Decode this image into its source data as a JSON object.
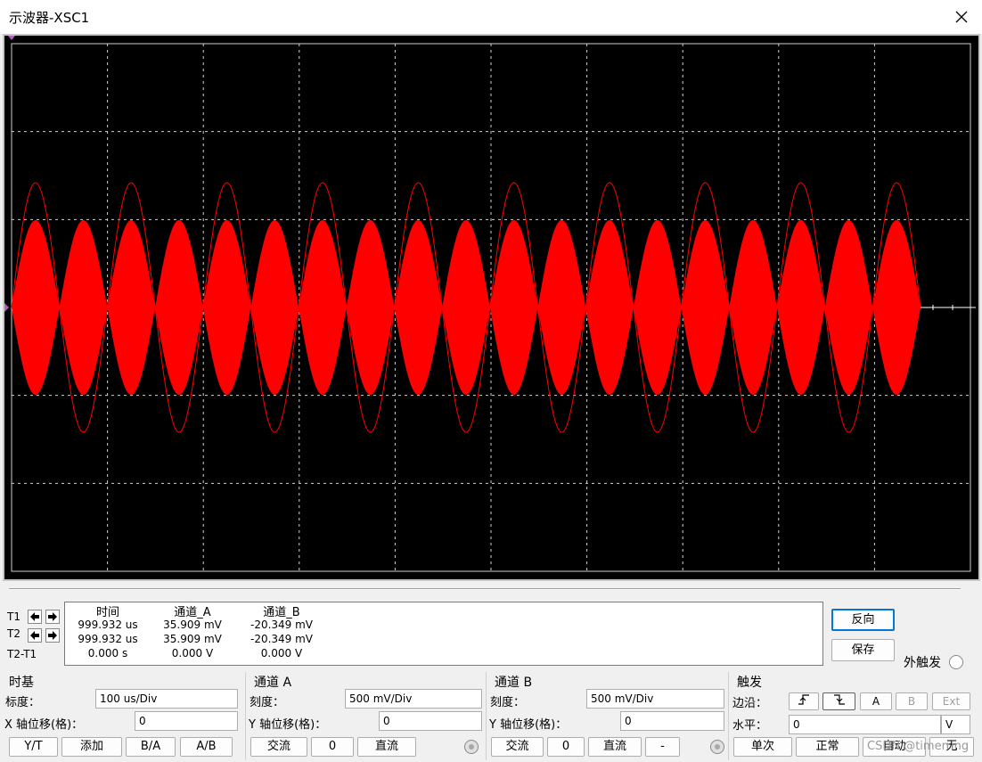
{
  "window": {
    "title": "示波器-XSC1"
  },
  "cursors": {
    "t1": "T1",
    "t2": "T2",
    "t2t1": "T2-T1"
  },
  "readout": {
    "headers": {
      "time": "时间",
      "channel_a": "通道_A",
      "channel_b": "通道_B"
    },
    "rows": [
      {
        "time": "999.932 us",
        "a": "35.909 mV",
        "b": "-20.349 mV"
      },
      {
        "time": "999.932 us",
        "a": "35.909 mV",
        "b": "-20.349 mV"
      },
      {
        "time": "0.000 s",
        "a": "0.000 V",
        "b": "0.000 V"
      }
    ]
  },
  "side": {
    "reverse": "反向",
    "save": "保存",
    "ext_trigger": "外触发"
  },
  "timebase": {
    "title": "时基",
    "scale_label": "标度：",
    "scale_value": "100 us/Div",
    "xpos_label": "X 轴位移(格)：",
    "xpos_value": "0",
    "buttons": [
      "Y/T",
      "添加",
      "B/A",
      "A/B"
    ]
  },
  "channel_a": {
    "title": "通道 A",
    "scale_label": "刻度：",
    "scale_value": "500 mV/Div",
    "ypos_label": "Y 轴位移(格)：",
    "ypos_value": "0",
    "buttons": [
      "交流",
      "0",
      "直流"
    ]
  },
  "channel_b": {
    "title": "通道 B",
    "scale_label": "刻度：",
    "scale_value": "500 mV/Div",
    "ypos_label": "Y 轴位移(格)：",
    "ypos_value": "0",
    "buttons": [
      "交流",
      "0",
      "直流",
      "-"
    ]
  },
  "trigger": {
    "title": "触发",
    "edge_label": "边沿：",
    "level_label": "水平：",
    "level_value": "0",
    "level_unit": "V",
    "sources": [
      "A",
      "B",
      "Ext"
    ],
    "modes": [
      "单次",
      "正常",
      "自动",
      "无"
    ]
  },
  "watermark": "CSDN @timerring",
  "colors": {
    "trace": "#ff0000",
    "grid": "#d0d0d0",
    "screen": "#000000"
  },
  "icons": [
    "close-icon",
    "arrow-left-icon",
    "arrow-right-icon",
    "rising-edge-icon",
    "falling-edge-icon"
  ]
}
